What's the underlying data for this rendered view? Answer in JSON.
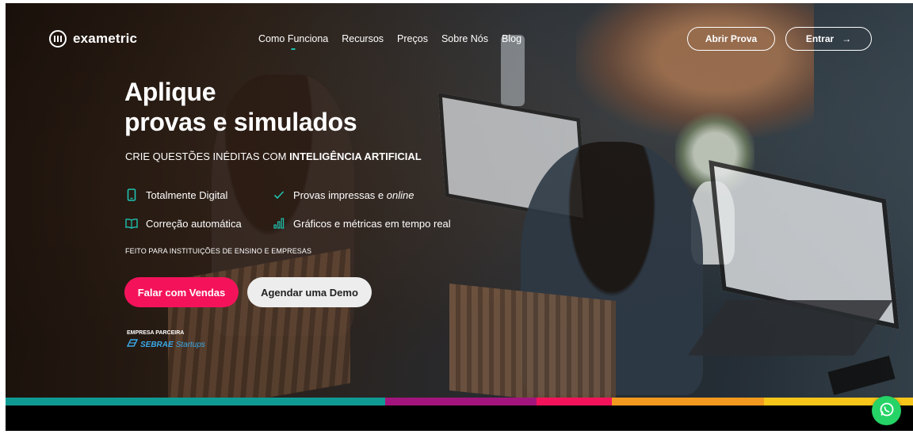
{
  "brand": {
    "name": "exametric"
  },
  "nav": {
    "items": [
      {
        "label": "Como Funciona",
        "active": true
      },
      {
        "label": "Recursos"
      },
      {
        "label": "Preços"
      },
      {
        "label": "Sobre Nós"
      },
      {
        "label": "Blog"
      }
    ],
    "abrir_prova": "Abrir Prova",
    "entrar": "Entrar",
    "entrar_arrow": "→"
  },
  "hero": {
    "headline_line1": "Aplique",
    "headline_line2": "provas e simulados",
    "sub_prefix": "CRIE QUESTÕES INÉDITAS COM ",
    "sub_bold": "INTELIGÊNCIA ARTIFICIAL",
    "features": [
      {
        "icon": "phone-icon",
        "label": "Totalmente Digital"
      },
      {
        "icon": "check-icon",
        "label": "Provas impressas e ",
        "italic": "online"
      },
      {
        "icon": "book-icon",
        "label": "Correção automática"
      },
      {
        "icon": "bar-chart-icon",
        "label": "Gráficos e métricas em tempo real"
      }
    ],
    "note": "FEITO PARA INSTITUIÇÕES DE ENSINO E EMPRESAS",
    "cta_sales": "Falar com Vendas",
    "cta_demo": "Agendar uma Demo",
    "partner_label": "EMPRESA PARCEIRA",
    "partner_name": "SEBRAE",
    "partner_suffix": "Startups"
  },
  "colors": {
    "accent_teal": "#1fc2b0",
    "accent_pink": "#f4135a",
    "stripe": [
      "#109a94",
      "#a2157c",
      "#f4135a",
      "#f29a1f",
      "#f7c61a"
    ],
    "whatsapp": "#25d366"
  }
}
